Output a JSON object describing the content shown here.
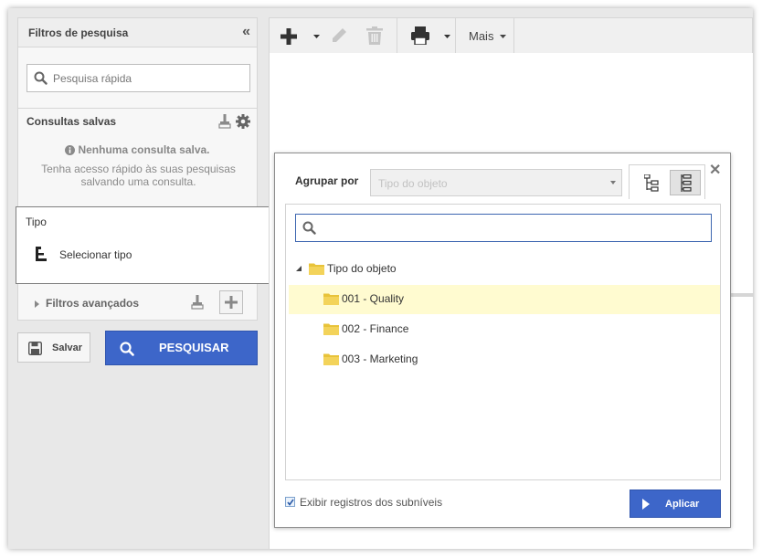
{
  "search_filters": {
    "title": "Filtros de pesquisa",
    "quick_search_placeholder": "Pesquisa rápida",
    "saved_queries_label": "Consultas salvas",
    "no_saved_query": "Nenhuma consulta salva.",
    "saved_query_hint": "Tenha acesso rápido às suas pesquisas salvando uma consulta.",
    "type_label": "Tipo",
    "select_type": "Selecionar tipo",
    "advanced_filters": "Filtros avançados"
  },
  "actions": {
    "save": "Salvar",
    "search": "PESQUISAR"
  },
  "toolbar": {
    "more": "Mais"
  },
  "group_dialog": {
    "group_by_label": "Agrupar por",
    "group_by_placeholder": "Tipo do objeto",
    "tree": {
      "root": "Tipo do objeto",
      "items": [
        "001 - Quality",
        "002 - Finance",
        "003 - Marketing"
      ]
    },
    "show_sublevels": "Exibir registros dos subníveis",
    "apply": "Aplicar"
  },
  "colors": {
    "primary": "#3d66c9",
    "highlight": "#fffbd0",
    "folder": "#e8c33a"
  }
}
